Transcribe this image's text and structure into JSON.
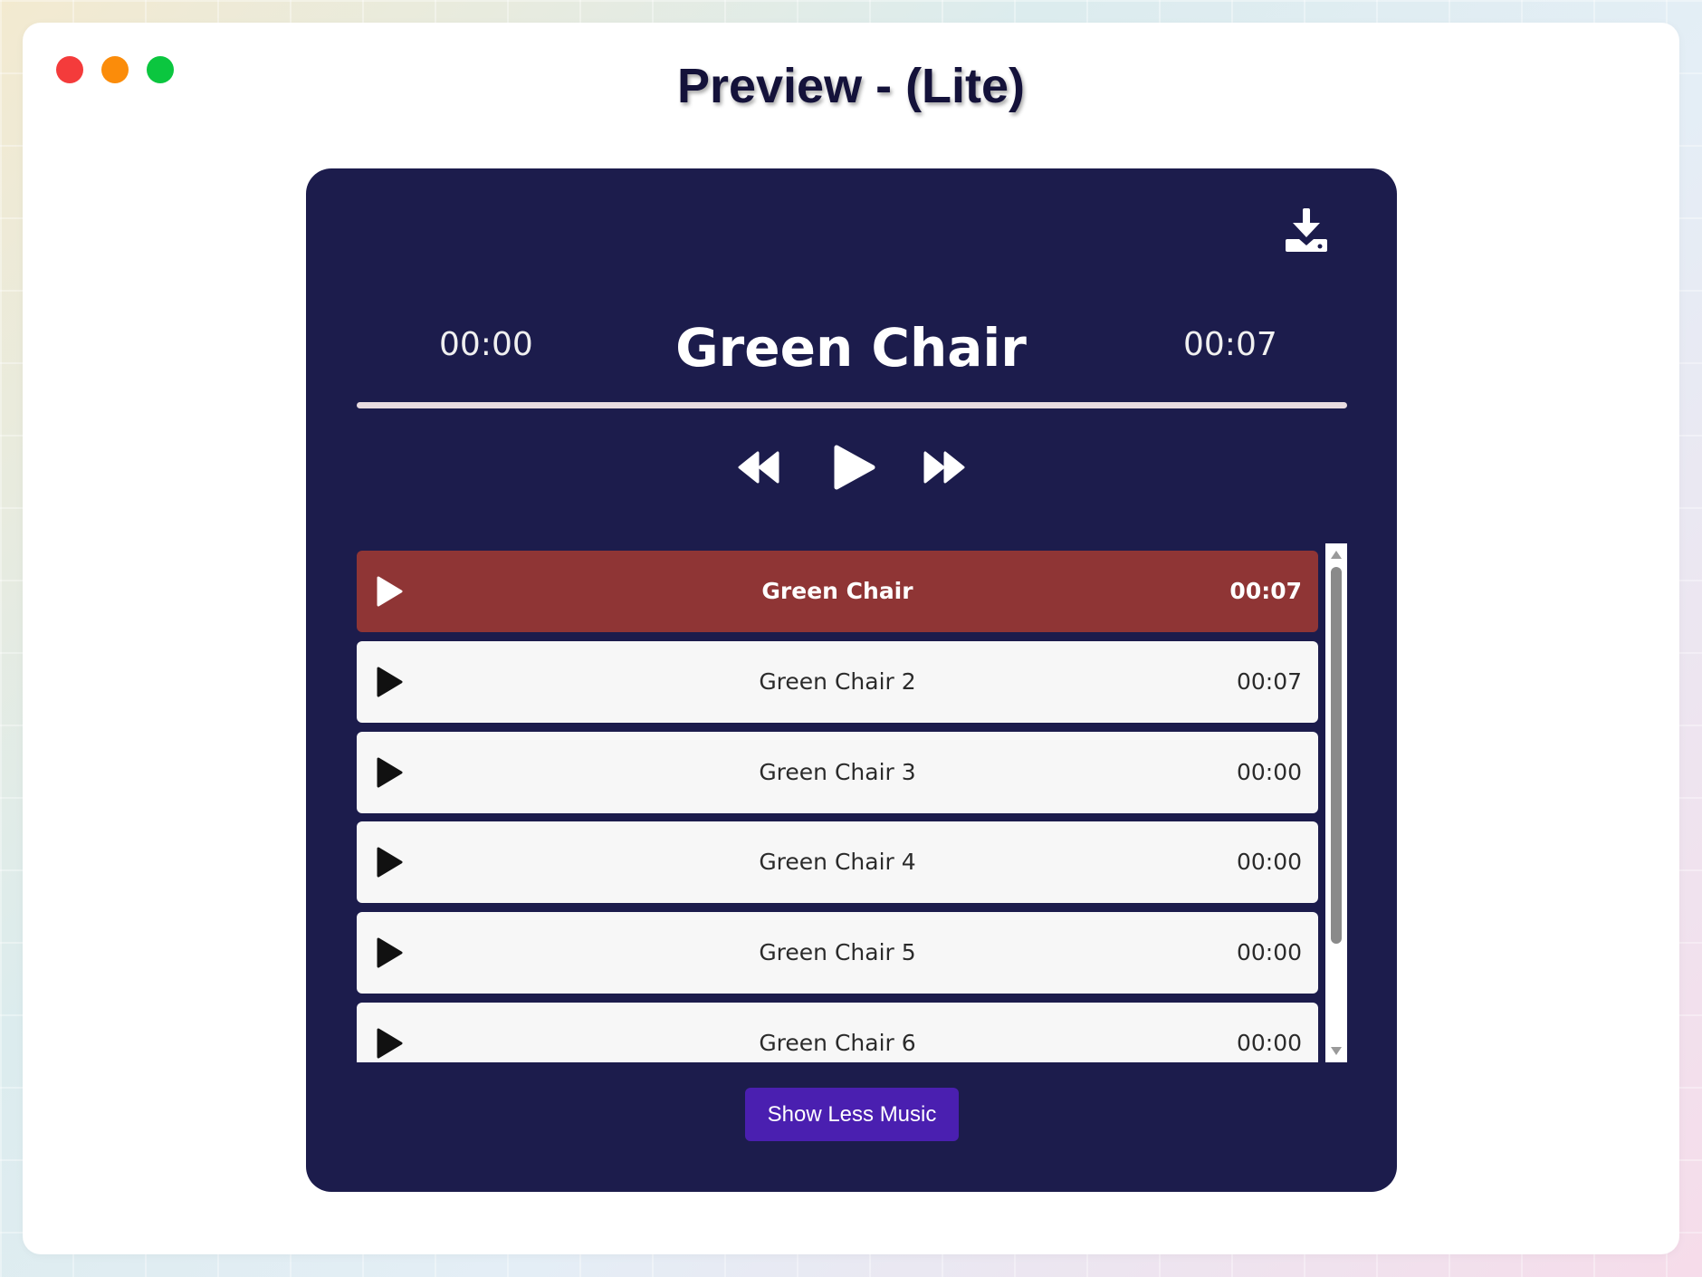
{
  "page": {
    "title": "Preview - (Lite)"
  },
  "window_controls": [
    "close",
    "minimize",
    "maximize"
  ],
  "player": {
    "current_time": "00:00",
    "track_title": "Green Chair",
    "total_time": "00:07",
    "progress": 0,
    "icons": {
      "download": "download-icon",
      "rewind": "rewind-icon",
      "play": "play-icon",
      "fast_forward": "fast-forward-icon"
    }
  },
  "playlist": {
    "items": [
      {
        "name": "Green Chair",
        "duration": "00:07",
        "active": true
      },
      {
        "name": "Green Chair 2",
        "duration": "00:07",
        "active": false
      },
      {
        "name": "Green Chair 3",
        "duration": "00:00",
        "active": false
      },
      {
        "name": "Green Chair 4",
        "duration": "00:00",
        "active": false
      },
      {
        "name": "Green Chair 5",
        "duration": "00:00",
        "active": false
      },
      {
        "name": "Green Chair 6",
        "duration": "00:00",
        "active": false
      }
    ]
  },
  "show_less_label": "Show Less Music",
  "colors": {
    "player_bg": "#1c1c4c",
    "active_row": "#8f3535",
    "button": "#4a1fb0"
  }
}
